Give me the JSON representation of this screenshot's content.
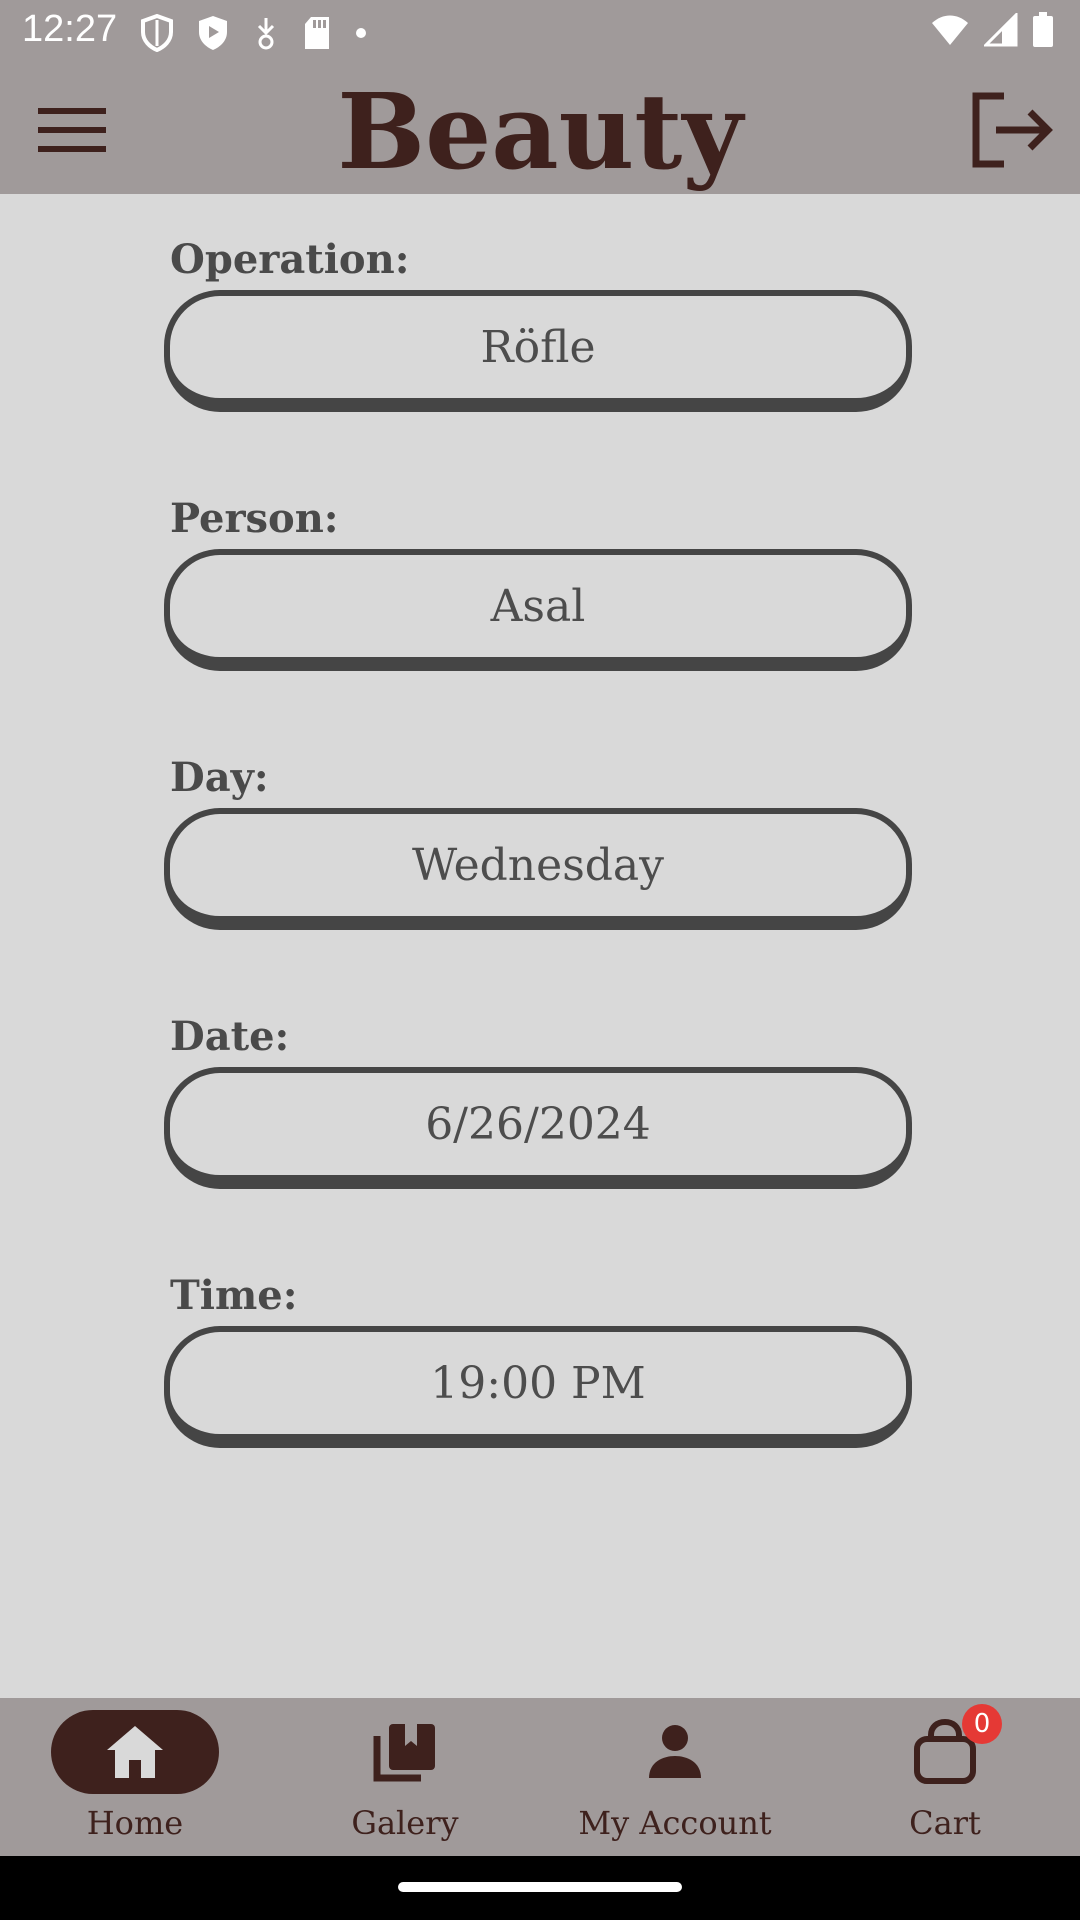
{
  "status_bar": {
    "time": "12:27",
    "left_icons": [
      "shield-outline-icon",
      "shield-filled-icon",
      "download-arrow-icon",
      "sd-card-icon",
      "dot-icon"
    ],
    "right_icons": [
      "wifi-icon",
      "cell-signal-icon",
      "battery-icon"
    ]
  },
  "app_bar": {
    "title": "Beauty",
    "menu_icon": "hamburger-menu-icon",
    "logout_icon": "logout-icon"
  },
  "form": {
    "fields": [
      {
        "label": "Operation:",
        "value": "Röfle"
      },
      {
        "label": "Person:",
        "value": "Asal"
      },
      {
        "label": "Day:",
        "value": "Wednesday"
      },
      {
        "label": "Date:",
        "value": "6/26/2024"
      },
      {
        "label": "Time:",
        "value": "19:00 PM"
      }
    ]
  },
  "bottom_nav": {
    "items": [
      {
        "label": "Home",
        "icon": "home-icon",
        "active": true
      },
      {
        "label": "Galery",
        "icon": "gallery-icon",
        "active": false
      },
      {
        "label": "My Account",
        "icon": "person-icon",
        "active": false
      },
      {
        "label": "Cart",
        "icon": "shopping-bag-icon",
        "active": false,
        "badge": "0"
      }
    ]
  },
  "colors": {
    "bar_background": "#a09a9a",
    "page_background": "#d9d9d9",
    "accent_brown": "#3e211d",
    "badge_red": "#e53935"
  }
}
